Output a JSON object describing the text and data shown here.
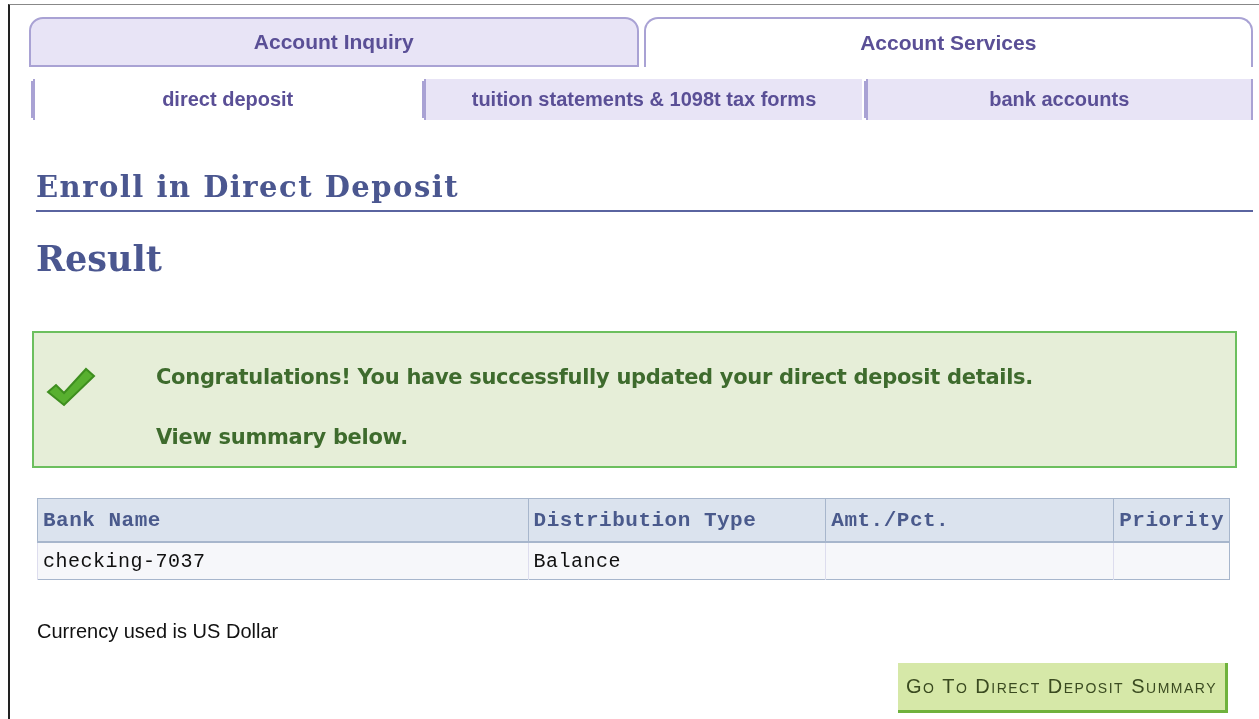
{
  "tabs": [
    {
      "label": "Account Inquiry",
      "selected": false
    },
    {
      "label": "Account Services",
      "selected": true
    }
  ],
  "subtabs": [
    {
      "label": "direct deposit",
      "selected": true
    },
    {
      "label": "tuition statements & 1098t tax forms",
      "selected": false
    },
    {
      "label": "bank accounts",
      "selected": false
    }
  ],
  "page_title": "Enroll in Direct Deposit",
  "section_title": "Result",
  "message": {
    "kind": "success",
    "lines": [
      "Congratulations! You have successfully updated your direct deposit details.",
      "View summary below."
    ]
  },
  "table": {
    "columns": [
      "Bank Name",
      "Distribution Type",
      "Amt./Pct.",
      "Priority"
    ],
    "rows": [
      [
        "checking-7037",
        "Balance",
        "",
        ""
      ]
    ]
  },
  "note": "Currency used is US Dollar",
  "button": "Go To Direct Deposit Summary"
}
